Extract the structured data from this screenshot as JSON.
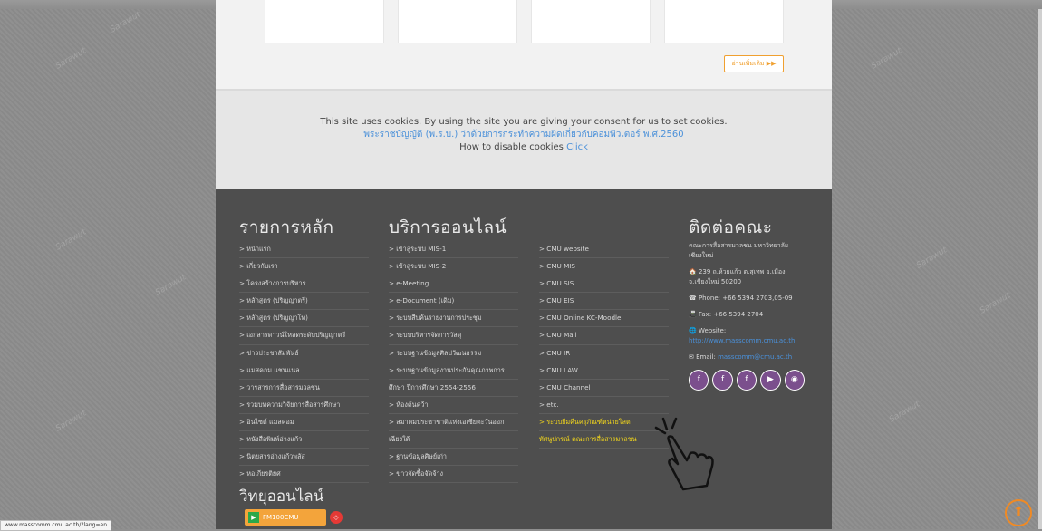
{
  "read_more": "อ่านเพิ่มเติม ▶▶",
  "cookie": {
    "line1": "This site uses cookies. By using the site you are giving your consent for us to set cookies.",
    "line2": "พระราชบัญญัติ (พ.ร.บ.) ว่าด้วยการกระทำความผิดเกี่ยวกับคอมพิวเตอร์ พ.ศ.2560",
    "line3_prefix": "How to disable cookies",
    "line3_link": "Click"
  },
  "footer": {
    "main_menu": {
      "title": "รายการหลัก",
      "items": [
        "> หน้าแรก",
        "> เกี่ยวกับเรา",
        "> โครงสร้างการบริหาร",
        "> หลักสูตร (ปริญญาตรี)",
        "> หลักสูตร (ปริญญาโท)",
        "> เอกสารดาวน์โหลดระดับปริญญาตรี",
        "> ข่าวประชาสัมพันธ์",
        "> แมสคอม แชนแนล",
        "> วารสารการสื่อสารมวลชน",
        "> รวมบทความวิจัยการสื่อสารศึกษา",
        "> อินไซด์ แมสคอม",
        "> หนังสือพิมพ์อ่างแก้ว",
        "> นิตยสารอ่างแก้วพลัส",
        "> หอเกียรติยศ"
      ]
    },
    "online_services": {
      "title": "บริการออนไลน์",
      "items": [
        "> เข้าสู่ระบบ MIS-1",
        "> เข้าสู่ระบบ MIS-2",
        "> e-Meeting",
        "> e-Document (เดิม)",
        "> ระบบสืบค้นรายงานการประชุม",
        "> ระบบบริหารจัดการวัสดุ",
        "> ระบบฐานข้อมูลศิลปวัฒนธรรม",
        "> ระบบฐานข้อมูลงานประกันคุณภาพการ",
        "ศึกษา ปีการศึกษา 2554-2556",
        "> ห้องค้นคว้า",
        "> สมาคมประชาชาติแห่งเอเชียตะวันออก",
        "เฉียงใต้",
        "> ฐานข้อมูลศิษย์เก่า",
        "> ข่าวจัดซื้อจัดจ้าง"
      ]
    },
    "links": {
      "items": [
        "> CMU website",
        "> CMU MIS",
        "> CMU SIS",
        "> CMU EIS",
        "> CMU Online KC-Moodle",
        "> CMU Mail",
        "> CMU IR",
        "> CMU LAW",
        "> CMU Channel",
        "> etc.",
        "> ระบบยืมคืนครุภัณฑ์หน่วยโสต",
        "ทัศนูปกรณ์ คณะการสื่อสารมวลชน"
      ]
    },
    "contact": {
      "title": "ติดต่อคณะ",
      "org": "คณะการสื่อสารมวลชน มหาวิทยาลัยเชียงใหม่",
      "address": "🏠 239 ถ.ห้วยแก้ว ต.สุเทพ อ.เมือง จ.เชียงใหม่ 50200",
      "phone": "☎ Phone: +66 5394 2703,05-09",
      "fax": "📠 Fax: +66 5394 2704",
      "website_label": "🌐 Website:",
      "website": "http://www.masscomm.cmu.ac.th",
      "email_label": "✉ Email:",
      "email": "masscomm@cmu.ac.th",
      "social": [
        "f",
        "f",
        "f",
        "▶",
        "◉"
      ]
    },
    "radio": {
      "title": "วิทยุออนไลน์",
      "button": "FM100CMU",
      "extra": "◇"
    }
  },
  "status_url": "www.masscomm.cmu.ac.th/?lang=en"
}
